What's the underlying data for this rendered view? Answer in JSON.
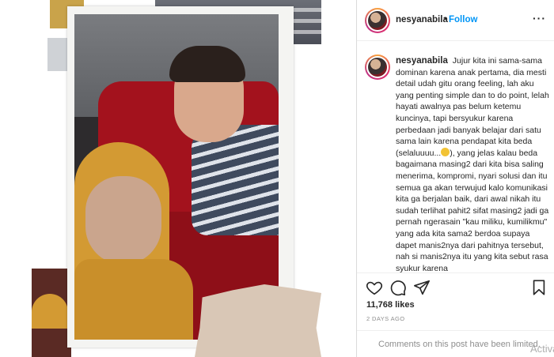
{
  "post": {
    "username": "nesyanabila",
    "separator": "•",
    "follow_label": "Follow",
    "more_label": "···",
    "caption": {
      "username": "nesyanabila",
      "text_before_emoji": "Jujur kita ini sama-sama dominan karena anak pertama, dia mesti detail udah gitu orang feeling, lah aku yang penting simple dan to do point, lelah hayati awalnya pas belum ketemu kuncinya, tapi bersyukur karena perbedaan jadi banyak belajar dari satu sama lain karena pendapat kita beda (selaluuuu...",
      "emoji": "smiling-emoji-icon",
      "text_after_emoji": "), yang jelas kalau beda bagaimana masing2 dari kita bisa saling menerima, kompromi, nyari solusi dan itu semua ga akan terwujud kalo komunikasi kita ga berjalan baik, dari awal nikah itu sudah terlihat pahit2 sifat masing2 jadi ga pernah ngerasain \"kau miliku, kumilikmu\" yang ada kita sama2 berdoa supaya dapet manis2nya dari pahitnya tersebut, nah si manis2nya itu yang kita sebut rasa syukur karena"
    },
    "actions": {
      "like": "heart-icon",
      "comment": "comment-icon",
      "share": "share-icon",
      "save": "bookmark-icon"
    },
    "likes": "11,768 likes",
    "timestamp": "2 DAYS AGO",
    "comments_limited": "Comments on this post have been limited.",
    "watermark": "Activate"
  },
  "colors": {
    "link_blue": "#0095f6",
    "text_primary": "#262626",
    "text_secondary": "#8e8e8e",
    "border": "#efefef"
  }
}
